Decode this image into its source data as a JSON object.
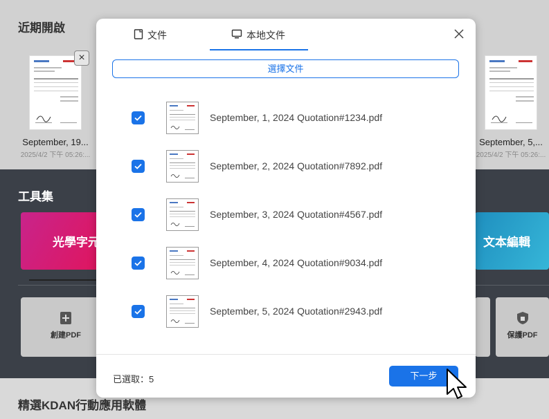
{
  "background": {
    "recent_title": "近期開啟",
    "recent_files": [
      {
        "name": "September, 19...",
        "date": "2025/4/2 下午 05:26:..."
      },
      {
        "name": "September, 5,...",
        "date": "2025/4/2 下午 05:26:..."
      }
    ],
    "remove_label": "×",
    "tools_title": "工具集",
    "banner_ocr": "光學字元",
    "banner_edit": "文本編輯",
    "tool_create": "創建PDF",
    "tool_protect": "保護PDF",
    "apps_title": "精選KDAN行動應用軟體"
  },
  "modal": {
    "tab_documents": "文件",
    "tab_local": "本地文件",
    "choose_button": "選擇文件",
    "files": [
      {
        "name": "September, 1, 2024 Quotation#1234.pdf",
        "checked": true
      },
      {
        "name": "September, 2, 2024 Quotation#7892.pdf",
        "checked": true
      },
      {
        "name": "September, 3, 2024 Quotation#4567.pdf",
        "checked": true
      },
      {
        "name": "September, 4, 2024 Quotation#9034.pdf",
        "checked": true
      },
      {
        "name": "September, 5, 2024 Quotation#2943.pdf",
        "checked": true
      }
    ],
    "selected_label": "已選取：5",
    "next_button": "下一步"
  },
  "colors": {
    "accent": "#1a73e8",
    "dark_panel": "#3b4048"
  }
}
